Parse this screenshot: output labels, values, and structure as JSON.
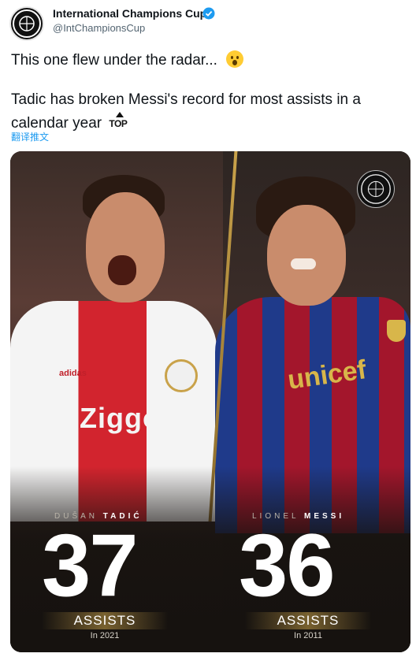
{
  "tweet": {
    "display_name": "International Champions Cup",
    "handle": "@IntChampionsCup",
    "line1": "This one flew under the radar...",
    "line3": "Tadic has broken Messi's record for most assists in a",
    "line4": "calendar year",
    "top_badge": "TOP",
    "translate": "翻译推文"
  },
  "media": {
    "left_player": {
      "first": "DUŠAN",
      "last": "TADIĆ",
      "number": "37",
      "label": "ASSISTS",
      "year": "In 2021"
    },
    "right_player": {
      "first": "LIONEL",
      "last": "MESSI",
      "number": "36",
      "label": "ASSISTS",
      "year": "In 2011"
    },
    "shirt_left_sponsor": "Ziggo",
    "shirt_left_brand": "adidas",
    "shirt_right_sponsor": "unicef"
  },
  "icons": [
    "icc-avatar-icon",
    "verified-badge-icon",
    "astonished-face-emoji-icon",
    "top-arrow-emoji-icon",
    "icc-logo-icon"
  ],
  "colors": {
    "link": "#1d9bf0",
    "verified": "#1d9bf0",
    "accent_gold": "#c9a24a"
  }
}
